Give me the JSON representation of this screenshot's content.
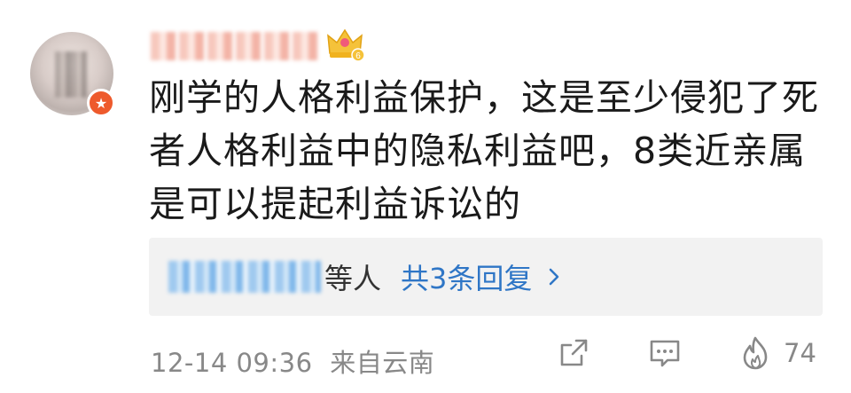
{
  "comment": {
    "text": "刚学的人格利益保护，这是至少侵犯了死者人格利益中的隐私利益吧，8类近亲属是可以提起利益诉讼的"
  },
  "user": {
    "level_badge": "6"
  },
  "replies": {
    "suffix": "等人",
    "count_label": "共3条回复"
  },
  "footer": {
    "timestamp": "12-14 09:36",
    "location": "来自云南",
    "like_count": "74"
  },
  "colors": {
    "link_blue": "#2f76c6",
    "muted": "#888888",
    "badge_orange": "#ee5a2c"
  }
}
